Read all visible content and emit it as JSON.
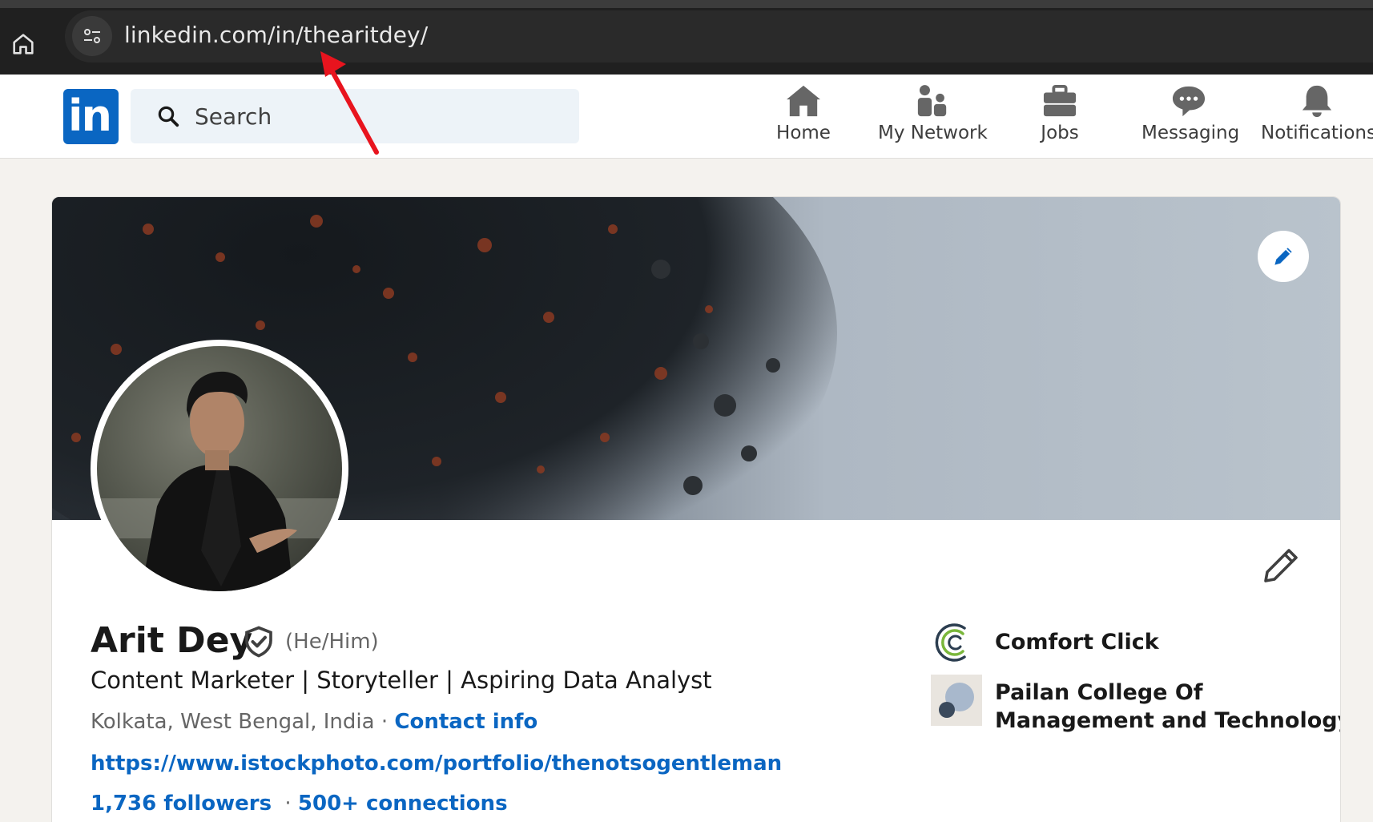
{
  "browser": {
    "url_host": "linkedin.com",
    "url_path": "/in/thearitdey/"
  },
  "nav": {
    "logo_text": "in",
    "search_placeholder": "Search",
    "items": [
      {
        "label": "Home",
        "icon": "home-icon"
      },
      {
        "label": "My Network",
        "icon": "network-icon"
      },
      {
        "label": "Jobs",
        "icon": "briefcase-icon"
      },
      {
        "label": "Messaging",
        "icon": "messaging-icon"
      },
      {
        "label": "Notifications",
        "icon": "bell-icon"
      }
    ]
  },
  "profile": {
    "name": "Arit Dey",
    "pronouns": "(He/Him)",
    "headline": "Content Marketer | Storyteller | Aspiring Data Analyst",
    "location": "Kolkata, West Bengal, India",
    "location_separator": "·",
    "contact_info_label": "Contact info",
    "website": "https://www.istockphoto.com/portfolio/thenotsogentleman",
    "followers": "1,736 followers",
    "stats_separator": "·",
    "connections": "500+ connections"
  },
  "organizations": [
    {
      "name": "Comfort Click",
      "icon": "comfort-click-logo"
    },
    {
      "name_line1": "Pailan College Of",
      "name_line2": "Management and Technology",
      "icon": "pailan-college-logo"
    }
  ],
  "colors": {
    "brand": "#0a66c2",
    "annotation_arrow": "#e8141e"
  }
}
